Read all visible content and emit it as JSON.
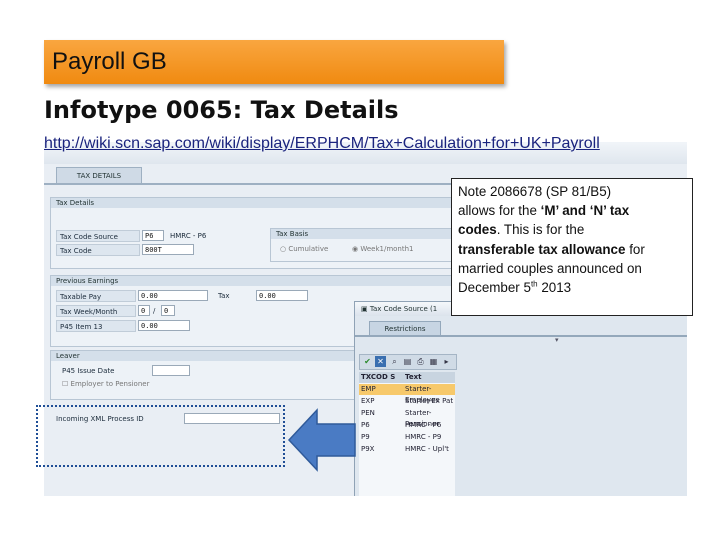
{
  "slide": {
    "banner": "Payroll GB",
    "heading": "Infotype 0065: Tax Details",
    "url": "http://wiki.scn.sap.com/wiki/display/ERPHCM/Tax+Calculation+for+UK+Payroll"
  },
  "sap": {
    "tab": "TAX DETAILS",
    "tax_details": {
      "header": "Tax Details",
      "tax_code_source_label": "Tax Code Source",
      "tax_code_source_value": "P6",
      "tax_code_source_desc": "HMRC - P6",
      "tax_code_label": "Tax Code",
      "tax_code_value": "800T",
      "tax_basis_header": "Tax Basis",
      "cumulative": "Cumulative",
      "week1": "Week1/month1"
    },
    "previous_earnings": {
      "header": "Previous Earnings",
      "taxable_pay_label": "Taxable Pay",
      "taxable_pay_value": "0.00",
      "tax_label": "Tax",
      "tax_value": "0.00",
      "tax_week_label": "Tax Week/Month",
      "tax_week_value": "0",
      "tax_week_sep": "/",
      "tax_month_value": "0",
      "p45_item_label": "P45 Item 13",
      "p45_item_value": "0.00"
    },
    "leaver": {
      "header": "Leaver",
      "p45_issue_label": "P45 Issue Date",
      "employer_pensioner": "Employer to Pensioner"
    },
    "incoming_xml_label": "Incoming XML Process ID"
  },
  "popup": {
    "title": "Tax Code Source (1",
    "tab": "Restrictions",
    "columns": [
      "TXCOD S",
      "Text"
    ],
    "rows": [
      [
        "EMP",
        "Starter-Employee"
      ],
      [
        "EXP",
        "Starter-Ex Pat"
      ],
      [
        "PEN",
        "Starter-Pensioner"
      ],
      [
        "P6",
        "HMRC - P6"
      ],
      [
        "P9",
        "HMRC - P9"
      ],
      [
        "P9X",
        "HMRC - Upl't"
      ]
    ]
  },
  "note": {
    "line1": "Note 2086678 (SP 81/B5)",
    "line2a": "allows for the ",
    "line2b": "‘M’ and ‘N’ tax",
    "line3a": "codes",
    "line3b": ". This is for the",
    "line4": "transferable tax allowance",
    "line4b": " for",
    "line5": "married couples announced on",
    "line6a": "December 5",
    "line6sup": "th",
    "line6b": " 2013"
  },
  "colors": {
    "banner": "#f39a26",
    "arrow": "#4a7bc4",
    "highlight": "#1f4e96",
    "selected_row": "#f7c96b"
  }
}
